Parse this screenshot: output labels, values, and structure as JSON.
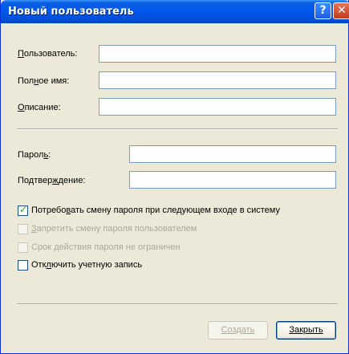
{
  "window": {
    "title": "Новый пользователь",
    "help_label": "?",
    "close_label": "✕"
  },
  "form": {
    "username": {
      "prefix": "П",
      "rest": "ользователь:",
      "value": ""
    },
    "fullname": {
      "pre": "Пол",
      "accel": "н",
      "post": "ое имя:",
      "value": ""
    },
    "description": {
      "accel": "О",
      "post": "писание:",
      "value": ""
    },
    "password": {
      "pre": "Парол",
      "accel": "ь",
      "post": ":",
      "value": ""
    },
    "confirm": {
      "pre": "Подтвер",
      "accel": "ж",
      "post": "дение:",
      "value": ""
    }
  },
  "checkboxes": [
    {
      "pre": "Потребо",
      "accel": "в",
      "post": "ать смену пароля при следующем входе в систему",
      "checked": true,
      "disabled": false
    },
    {
      "pre": "",
      "accel": "З",
      "post": "апретить смену пароля пользователем",
      "checked": false,
      "disabled": true
    },
    {
      "pre": "Срок ",
      "accel": "д",
      "post": "ействия пароля не ограничен",
      "checked": false,
      "disabled": true
    },
    {
      "pre": "Отк",
      "accel": "л",
      "post": "ючить учетную запись",
      "checked": false,
      "disabled": false
    }
  ],
  "buttons": {
    "create_label": "Создать",
    "close_label": "Закрыть"
  }
}
